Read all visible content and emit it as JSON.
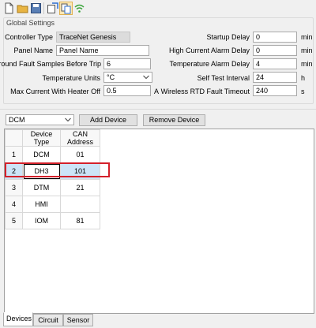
{
  "toolbar": {
    "icons": [
      "new-file-icon",
      "open-folder-icon",
      "save-icon",
      "export-icon",
      "transfer-icon",
      "wifi-icon"
    ]
  },
  "global_settings": {
    "title": "Global Settings",
    "controller_type": {
      "label": "Controller Type",
      "value": "TraceNet Genesis"
    },
    "panel_name": {
      "label": "Panel Name",
      "value": "Panel Name"
    },
    "ground_fault": {
      "label": "Ground Fault Samples Before Trip",
      "value": "6"
    },
    "temperature_units": {
      "label": "Temperature Units",
      "value": "°C"
    },
    "max_current": {
      "label": "Max Current With Heater Off",
      "value": "0.5",
      "unit": "A"
    },
    "startup_delay": {
      "label": "Startup Delay",
      "value": "0",
      "unit": "min"
    },
    "high_current_alarm": {
      "label": "High Current Alarm Delay",
      "value": "0",
      "unit": "min"
    },
    "temperature_alarm": {
      "label": "Temperature Alarm Delay",
      "value": "4",
      "unit": "min"
    },
    "self_test": {
      "label": "Self Test Interval",
      "value": "24",
      "unit": "h"
    },
    "wireless_rtd": {
      "label": "Wireless RTD Fault Timeout",
      "value": "240",
      "unit": "s"
    }
  },
  "device_select": {
    "value": "DCM"
  },
  "buttons": {
    "add_device": "Add Device",
    "remove_device": "Remove Device"
  },
  "grid": {
    "headers": [
      "Device Type",
      "CAN Address"
    ],
    "rows": [
      {
        "num": "1",
        "type": "DCM",
        "address": "01"
      },
      {
        "num": "2",
        "type": "DH3",
        "address": "101"
      },
      {
        "num": "3",
        "type": "DTM",
        "address": "21"
      },
      {
        "num": "4",
        "type": "HMI",
        "address": ""
      },
      {
        "num": "5",
        "type": "IOM",
        "address": "81"
      }
    ]
  },
  "tabs": [
    "Devices",
    "Circuit",
    "Sensor"
  ],
  "colors": {
    "highlight": "#d4202a",
    "selection": "#cce4f7"
  }
}
